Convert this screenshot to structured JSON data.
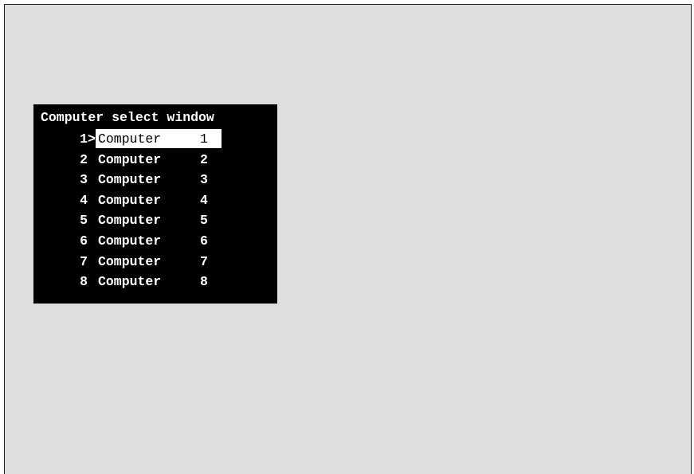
{
  "osd": {
    "title": "Computer select window",
    "selected_index": 0,
    "cursor_glyph": ">",
    "items": [
      {
        "number": "1",
        "name": "Computer",
        "id": "1"
      },
      {
        "number": "2",
        "name": "Computer",
        "id": "2"
      },
      {
        "number": "3",
        "name": "Computer",
        "id": "3"
      },
      {
        "number": "4",
        "name": "Computer",
        "id": "4"
      },
      {
        "number": "5",
        "name": "Computer",
        "id": "5"
      },
      {
        "number": "6",
        "name": "Computer",
        "id": "6"
      },
      {
        "number": "7",
        "name": "Computer",
        "id": "7"
      },
      {
        "number": "8",
        "name": "Computer",
        "id": "8"
      }
    ]
  },
  "colors": {
    "screen_background": "#dedede",
    "osd_background": "#000000",
    "osd_text": "#ffffff",
    "highlight_background": "#ffffff",
    "highlight_text": "#000000"
  }
}
